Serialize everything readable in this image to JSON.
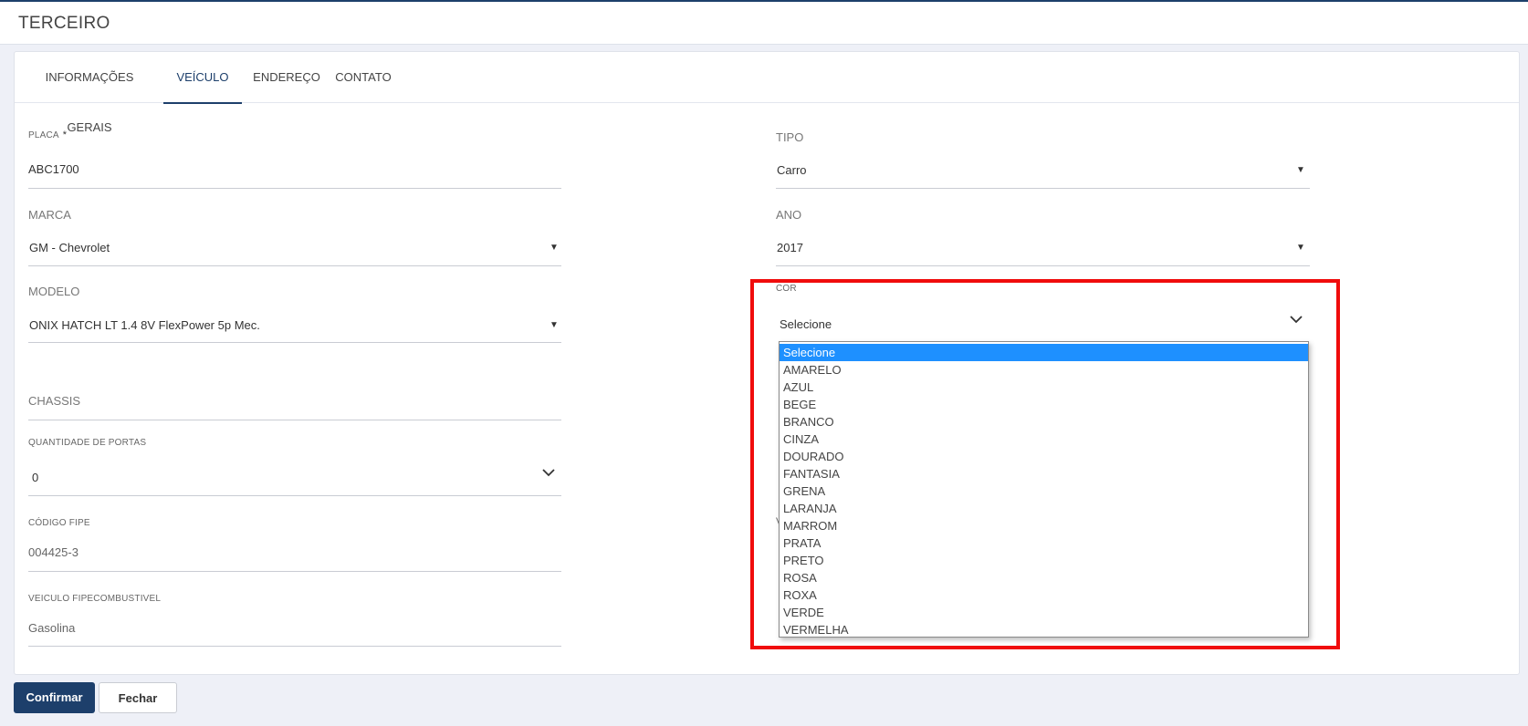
{
  "page": {
    "title": "TERCEIRO"
  },
  "tabs": [
    {
      "label": "INFORMAÇÕES GERAIS"
    },
    {
      "label": "VEÍCULO"
    },
    {
      "label": "ENDEREÇO"
    },
    {
      "label": "CONTATO"
    }
  ],
  "form": {
    "placa": {
      "label": "PLACA",
      "required": "*",
      "value": "ABC1700"
    },
    "marca": {
      "label": "MARCA",
      "value": "GM - Chevrolet"
    },
    "modelo": {
      "label": "MODELO",
      "value": "ONIX HATCH LT 1.4 8V FlexPower 5p Mec."
    },
    "chassis": {
      "label": "CHASSIS",
      "value": ""
    },
    "portas": {
      "label": "QUANTIDADE DE PORTAS",
      "value": "0"
    },
    "codigo_fipe": {
      "label": "CÓDIGO FIPE",
      "value": "004425-3"
    },
    "combustivel": {
      "label": "VEICULO FIPECOMBUSTIVEL",
      "value": "Gasolina"
    },
    "tipo": {
      "label": "TIPO",
      "value": "Carro"
    },
    "ano": {
      "label": "ANO",
      "value": "2017"
    },
    "cor": {
      "label": "COR",
      "value": "Selecione",
      "options": [
        "Selecione",
        "AMARELO",
        "AZUL",
        "BEGE",
        "BRANCO",
        "CINZA",
        "DOURADO",
        "FANTASIA",
        "GRENA",
        "LARANJA",
        "MARROM",
        "PRATA",
        "PRETO",
        "ROSA",
        "ROXA",
        "VERDE",
        "VERMELHA"
      ]
    }
  },
  "buttons": {
    "confirm": "Confirmar",
    "close": "Fechar"
  },
  "colors": {
    "primary": "#1d3f6b",
    "highlight": "#f00c0c",
    "selected_option": "#1e90ff"
  }
}
